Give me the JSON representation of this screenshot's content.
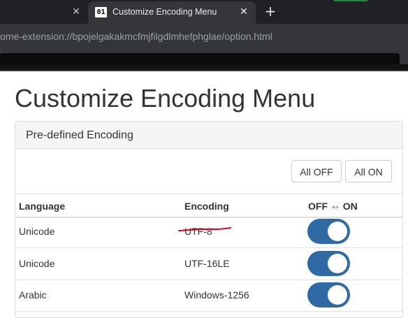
{
  "browser": {
    "active_tab": {
      "favicon_text": "01",
      "title": "Customize Encoding Menu"
    },
    "url": "ome-extension://bpojelgakakmcfmjfilgdlmhefphglae/option.html"
  },
  "page": {
    "title": "Customize Encoding Menu",
    "panel_title": "Pre-defined Encoding",
    "buttons": {
      "all_off": "All OFF",
      "all_on": "All ON"
    },
    "table": {
      "headers": {
        "language": "Language",
        "encoding": "Encoding",
        "toggle": "OFF ⇔ ON"
      },
      "rows": [
        {
          "language": "Unicode",
          "encoding": "UTF-8",
          "on": true
        },
        {
          "language": "Unicode",
          "encoding": "UTF-16LE",
          "on": true
        },
        {
          "language": "Arabic",
          "encoding": "Windows-1256",
          "on": true
        }
      ]
    }
  },
  "colors": {
    "toggle_on": "#2f6aa5",
    "annotation": "#d0021b"
  }
}
